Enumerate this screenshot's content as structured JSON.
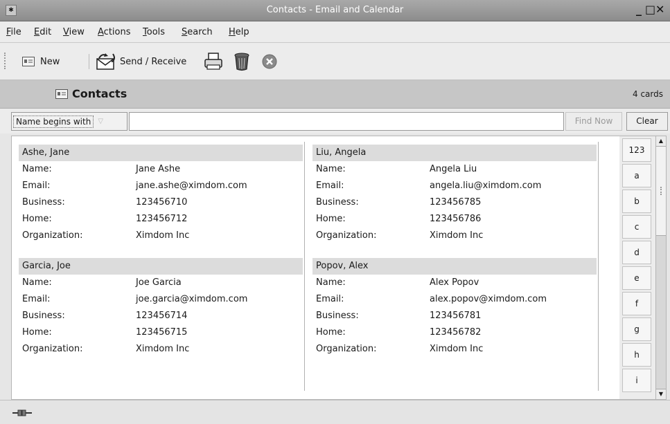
{
  "window": {
    "title": "Contacts - Email and Calendar",
    "app_icon": "app-icon"
  },
  "menu": [
    "File",
    "Edit",
    "View",
    "Actions",
    "Tools",
    "Search",
    "Help"
  ],
  "toolbar": {
    "new_label": "New",
    "send_receive_label": "Send / Receive",
    "icons": [
      "contact-card-icon",
      "send-receive-icon",
      "print-icon",
      "delete-icon",
      "stop-icon"
    ]
  },
  "header": {
    "title": "Contacts",
    "count": "4 cards"
  },
  "search": {
    "mode": "Name begins with",
    "value": "",
    "find_label": "Find Now",
    "clear_label": "Clear"
  },
  "labels": {
    "name": "Name:",
    "email": "Email:",
    "business": "Business:",
    "home": "Home:",
    "organization": "Organization:"
  },
  "contacts": [
    {
      "file_as": "Ashe, Jane",
      "name": "Jane Ashe",
      "email": "jane.ashe@ximdom.com",
      "business": "123456710",
      "home": "123456712",
      "organization": "Ximdom Inc"
    },
    {
      "file_as": "Garcia, Joe",
      "name": "Joe Garcia",
      "email": "joe.garcia@ximdom.com",
      "business": "123456714",
      "home": "123456715",
      "organization": "Ximdom Inc"
    },
    {
      "file_as": "Liu, Angela",
      "name": "Angela Liu",
      "email": "angela.liu@ximdom.com",
      "business": "123456785",
      "home": "123456786",
      "organization": "Ximdom Inc"
    },
    {
      "file_as": "Popov, Alex",
      "name": "Alex Popov",
      "email": "alex.popov@ximdom.com",
      "business": "123456781",
      "home": "123456782",
      "organization": "Ximdom Inc"
    }
  ],
  "index_letters": [
    "123",
    "a",
    "b",
    "c",
    "d",
    "e",
    "f",
    "g",
    "h",
    "i"
  ]
}
